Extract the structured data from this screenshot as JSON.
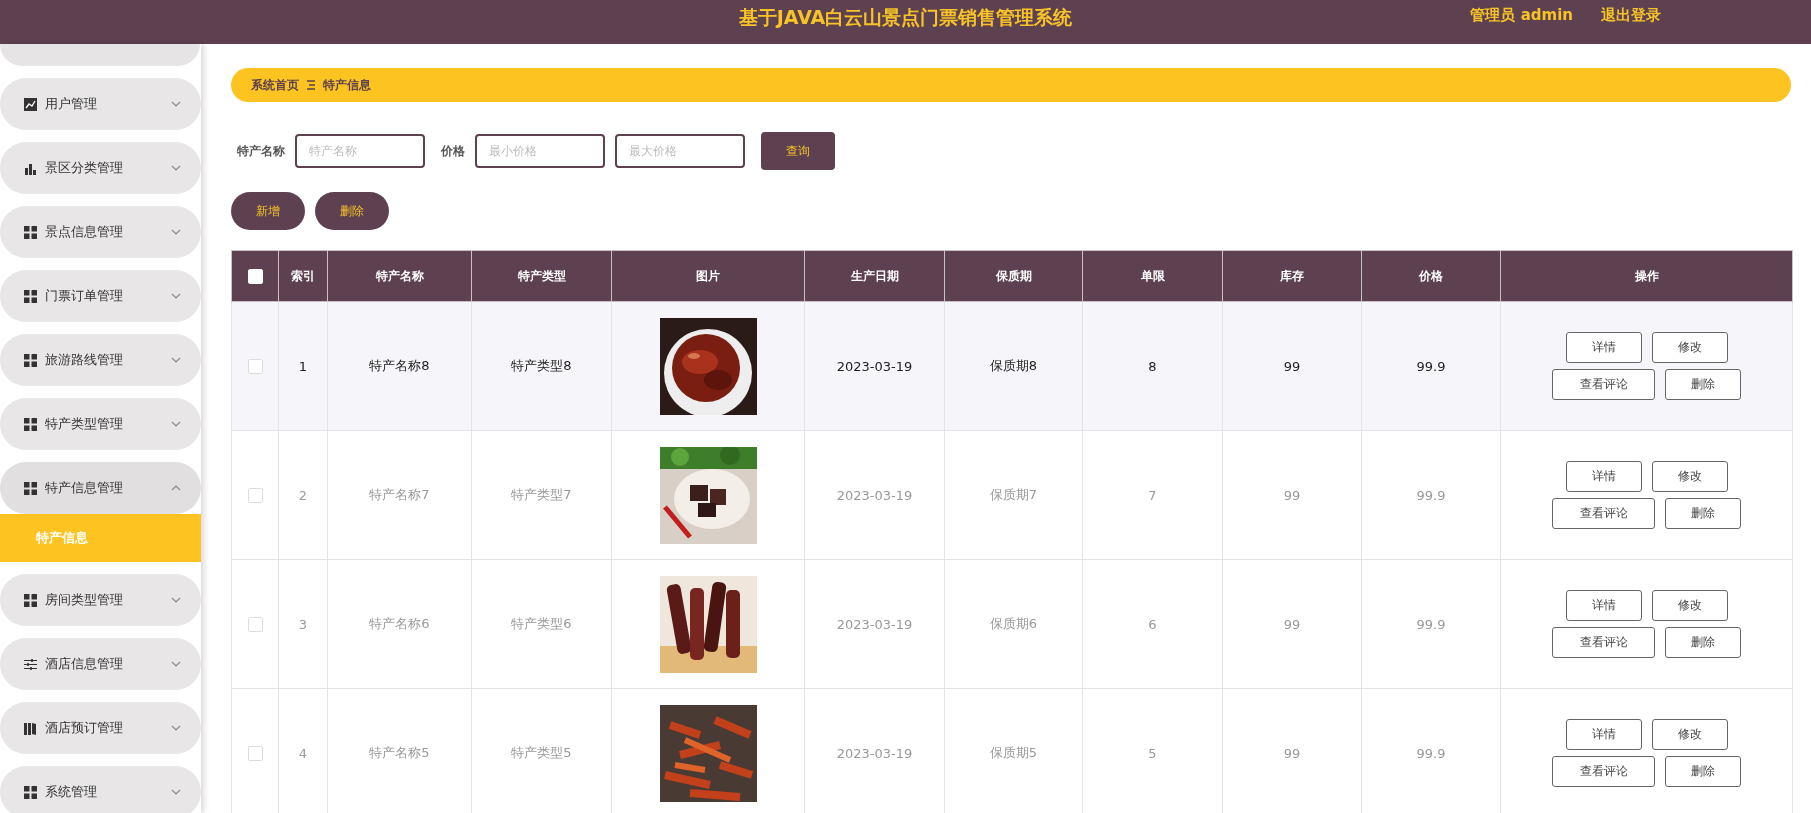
{
  "header": {
    "title": "基于JAVA白云山景点门票销售管理系统",
    "user": "管理员 admin",
    "logout": "退出登录"
  },
  "sidebar": {
    "items": [
      {
        "label": "用户管理",
        "expanded": false
      },
      {
        "label": "景区分类管理",
        "expanded": false
      },
      {
        "label": "景点信息管理",
        "expanded": false
      },
      {
        "label": "门票订单管理",
        "expanded": false
      },
      {
        "label": "旅游路线管理",
        "expanded": false
      },
      {
        "label": "特产类型管理",
        "expanded": false
      },
      {
        "label": "特产信息管理",
        "expanded": true,
        "children": [
          {
            "label": "特产信息",
            "selected": true
          }
        ]
      },
      {
        "label": "房间类型管理",
        "expanded": false
      },
      {
        "label": "酒店信息管理",
        "expanded": false
      },
      {
        "label": "酒店预订管理",
        "expanded": false
      },
      {
        "label": "系统管理",
        "expanded": false
      }
    ]
  },
  "breadcrumb": [
    "系统首页",
    "特产信息"
  ],
  "search": {
    "fields": [
      {
        "label": "特产名称",
        "placeholder": "特产名称"
      },
      {
        "label": "价格",
        "placeholder": "最小价格"
      },
      {
        "placeholder": "最大价格"
      }
    ],
    "button": "查询"
  },
  "actions": [
    "新增",
    "删除"
  ],
  "table": {
    "select_all": {
      "checked": false
    },
    "columns": [
      "索引",
      "特产名称",
      "特产类型",
      "图片",
      "生产日期",
      "保质期",
      "单限",
      "库存",
      "价格",
      "操作"
    ],
    "rows": [
      {
        "checked": false,
        "hovered": true,
        "cells": [
          "1",
          "特产名称8",
          "特产类型8",
          {
            "kind": "picture"
          },
          "2023-03-19",
          "保质期8",
          "8",
          "99",
          "99.9"
        ],
        "actions": [
          "详情",
          "修改",
          "查看评论",
          "删除"
        ]
      },
      {
        "checked": false,
        "hovered": false,
        "cells": [
          "2",
          "特产名称7",
          "特产类型7",
          {
            "kind": "picture"
          },
          "2023-03-19",
          "保质期7",
          "7",
          "99",
          "99.9"
        ],
        "actions": [
          "详情",
          "修改",
          "查看评论",
          "删除"
        ]
      },
      {
        "checked": false,
        "hovered": false,
        "cells": [
          "3",
          "特产名称6",
          "特产类型6",
          {
            "kind": "picture"
          },
          "2023-03-19",
          "保质期6",
          "6",
          "99",
          "99.9"
        ],
        "actions": [
          "详情",
          "修改",
          "查看评论",
          "删除"
        ]
      },
      {
        "checked": false,
        "hovered": false,
        "cells": [
          "4",
          "特产名称5",
          "特产类型5",
          {
            "kind": "picture"
          },
          "2023-03-19",
          "保质期5",
          "5",
          "99",
          "99.9"
        ],
        "actions": [
          "详情",
          "修改",
          "查看评论",
          "删除"
        ]
      }
    ]
  }
}
